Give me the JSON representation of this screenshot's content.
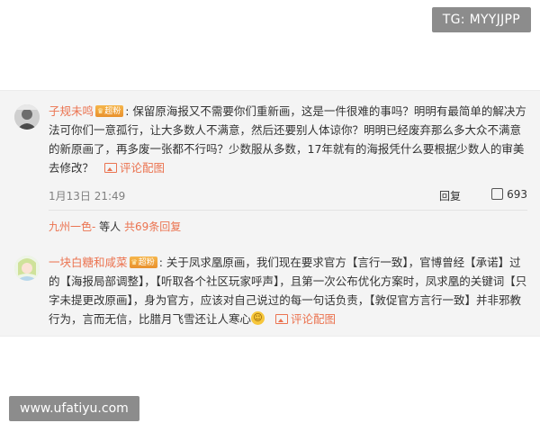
{
  "watermarks": {
    "top": "TG: MYYJJPP",
    "bottom": "www.ufatiyu.com"
  },
  "comments": [
    {
      "username": "子规未鸣",
      "badge": "超粉",
      "colon": ":",
      "text": "保留原海报又不需要你们重新画，这是一件很难的事吗？明明有最简单的解决方法可你们一意孤行，让大多数人不满意，然后还要别人体谅你？明明已经废弃那么多大众不满意的新原画了，再多废一张都不行吗？少数服从多数，17年就有的海报凭什么要根据少数人的审美去修改？",
      "pic_link": "评论配图",
      "time": "1月13日 21:49",
      "reply_label": "回复",
      "likes": "693",
      "sub_reply_user": "九州一色-",
      "sub_reply_mid": " 等人 ",
      "sub_reply_count": "共69条回复"
    },
    {
      "username": "一块白糖和咸菜",
      "badge": "超粉",
      "colon": ":",
      "text": "关于凤求凰原画，我们现在要求官方【言行一致】，官博曾经【承诺】过的【海报局部调整】，【听取各个社区玩家呼声】，且第一次公布优化方案时，凤求凰的关键词【只字未提更改原画】，身为官方，应该对自己说过的每一句话负责，【敦促官方言行一致】并非邪教行为，言而无信，比腊月飞雪还让人寒心",
      "pic_link": "评论配图"
    }
  ],
  "icons": {
    "avatar_1": "avatar",
    "avatar_2": "avatar",
    "pic": "image-icon",
    "like": "like-icon",
    "emoji": "smile-emoji-icon"
  },
  "colors": {
    "accent": "#eb7350",
    "panel_bg": "#f4f4f4",
    "badge": "#f0a03a"
  }
}
